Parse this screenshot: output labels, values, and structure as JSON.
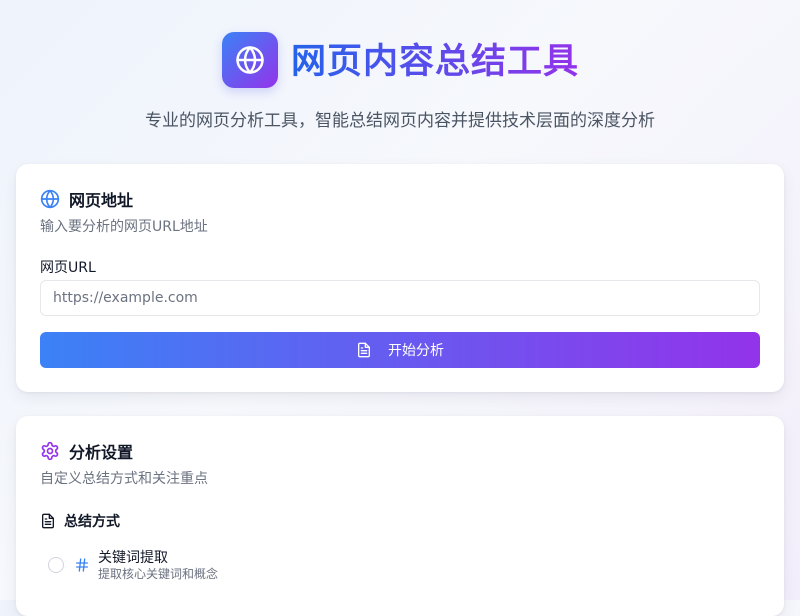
{
  "header": {
    "title": "网页内容总结工具",
    "subtitle": "专业的网页分析工具，智能总结网页内容并提供技术层面的深度分析",
    "logo_icon": "globe-icon"
  },
  "url_card": {
    "title": "网页地址",
    "title_icon": "globe-icon",
    "description": "输入要分析的网页URL地址",
    "field_label": "网页URL",
    "input_value": "",
    "input_placeholder": "https://example.com",
    "button_label": "开始分析",
    "button_icon": "document-icon"
  },
  "settings_card": {
    "title": "分析设置",
    "title_icon": "gear-icon",
    "description": "自定义总结方式和关注重点",
    "section_label": "总结方式",
    "section_icon": "document-icon",
    "options": [
      {
        "label": "关键词提取",
        "description": "提取核心关键词和概念",
        "icon": "hash-icon",
        "selected": false
      }
    ]
  },
  "colors": {
    "gradient_start": "#3b82f6",
    "gradient_end": "#9333ea",
    "title_gradient_start": "#2563eb",
    "muted_text": "#6b7280"
  }
}
